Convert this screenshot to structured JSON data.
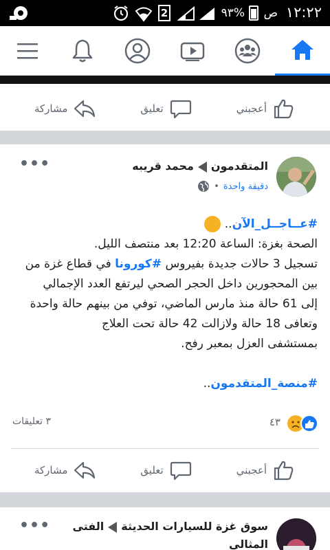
{
  "status_bar": {
    "time": "١٢:٢٢",
    "ampm": "ص",
    "battery_percent": "٩٣%",
    "sim": "2"
  },
  "nav": {
    "items": [
      {
        "name": "home-icon",
        "active": true
      },
      {
        "name": "groups-icon",
        "active": false
      },
      {
        "name": "watch-icon",
        "active": false
      },
      {
        "name": "profile-icon",
        "active": false
      },
      {
        "name": "bell-icon",
        "active": false
      },
      {
        "name": "menu-icon",
        "active": false
      }
    ],
    "accent": "#1877f2"
  },
  "actions": {
    "like": "أعجبني",
    "comment": "تعليق",
    "share": "مشاركة"
  },
  "post1": {
    "page_name": "المتقدمون",
    "author": "محمد قريبه",
    "time": "دقيقة واحدة",
    "line1_tag": "#عــاجــل_الآن",
    "line1_tail": "..",
    "line2": "الصحة بغزة: الساعة 12:20 بعد منتصف الليل.",
    "line3_a": "تسجيل 3  حالات جديدة بفيروس ",
    "line3_tag": "#كورونا",
    "line3_b": " في قطاع غزة من",
    "line4": "بين المحجورين داخل الحجر الصحي ليرتفع العدد الإجمالي",
    "line5": "إلى 61 حالة منذ مارس الماضي، توفي من بينهم حالة واحدة",
    "line6": "وتعافى 18 حالة ولازالت 42 حالة تحت العلاج",
    "line7": "بمستشفى العزل بمعبر رفح.",
    "footer_tag": "#منصة_المتقدمون",
    "footer_tail": "..",
    "reactions_count": "٤٣",
    "comments": "٣ تعليقات"
  },
  "post2": {
    "page_name": "سوق غزة للسيارات  الحديثة",
    "author": "الفتى",
    "author_line2": "المثالي"
  }
}
